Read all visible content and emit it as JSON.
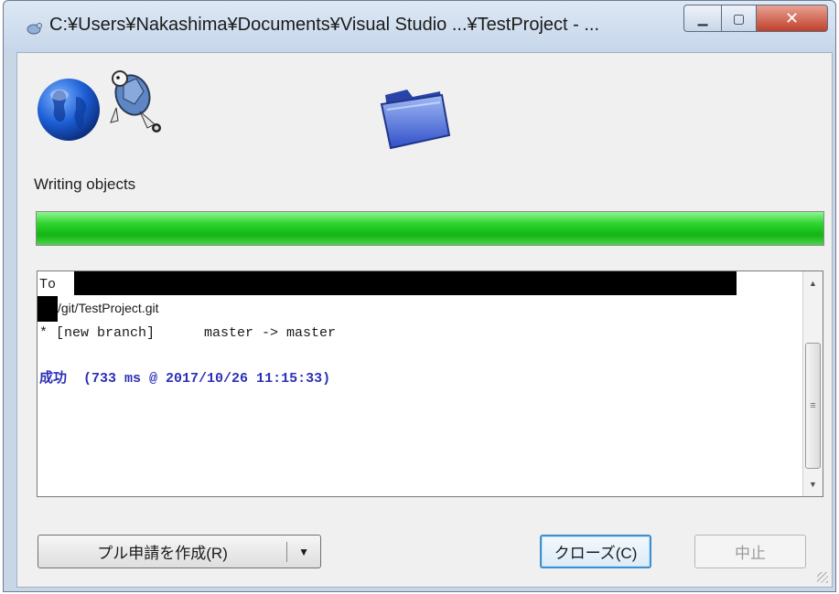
{
  "window": {
    "title": "C:¥Users¥Nakashima¥Documents¥Visual Studio ...¥TestProject - ..."
  },
  "status": {
    "label": "Writing objects",
    "progress_fraction": 1.0,
    "progress_color": "#1fc21f"
  },
  "icons": {
    "app": "tortoisegit-icon",
    "remote": "globe-icon",
    "turtle": "turtle-icon",
    "local": "folder-icon"
  },
  "log": {
    "line1": "To",
    "line2": "/git/TestProject.git",
    "line3": "* [new branch]      master -> master",
    "result_label": "成功",
    "result_detail": "(733 ms @ 2017/10/26 11:15:33)",
    "result_color": "#2b2fb8"
  },
  "buttons": {
    "pull_request": "プル申請を作成(R)",
    "close": "クローズ(C)",
    "abort": "中止"
  }
}
